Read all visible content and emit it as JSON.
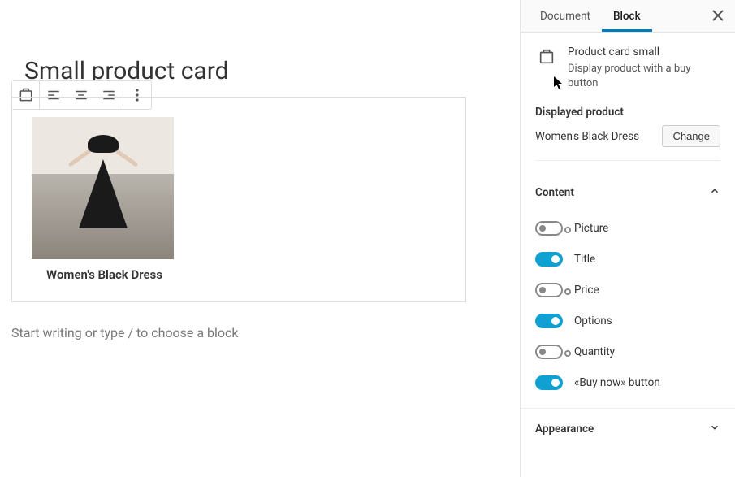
{
  "editor": {
    "page_title": "Small product card",
    "product_name": "Women's Black Dress",
    "placeholder": "Start writing or type / to choose a block"
  },
  "sidebar": {
    "tabs": {
      "document": "Document",
      "block": "Block"
    },
    "block_info": {
      "title": "Product card small",
      "description": "Display product with a buy button"
    },
    "displayed_product": {
      "label": "Displayed product",
      "value": "Women's Black Dress",
      "change": "Change"
    },
    "content": {
      "label": "Content",
      "toggles": [
        {
          "label": "Picture",
          "on": false
        },
        {
          "label": "Title",
          "on": true
        },
        {
          "label": "Price",
          "on": false
        },
        {
          "label": "Options",
          "on": true
        },
        {
          "label": "Quantity",
          "on": false
        },
        {
          "label": "«Buy now» button",
          "on": true
        }
      ]
    },
    "appearance": {
      "label": "Appearance"
    }
  }
}
